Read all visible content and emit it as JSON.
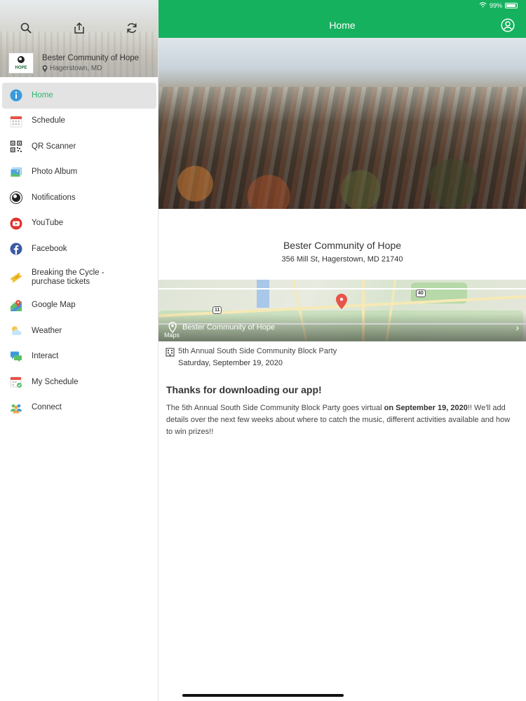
{
  "status_bar": {
    "wifi_icon": "wifi-icon",
    "battery": "99%"
  },
  "sidebar": {
    "org_name": "Bester Community of Hope",
    "org_location": "Hagerstown, MD",
    "logo_text": "HOPE",
    "tools": [
      "search-icon",
      "share-icon",
      "refresh-icon"
    ],
    "items": [
      {
        "label": "Home",
        "icon": "info-icon",
        "active": true
      },
      {
        "label": "Schedule",
        "icon": "calendar-icon"
      },
      {
        "label": "QR Scanner",
        "icon": "qr-code-icon"
      },
      {
        "label": "Photo Album",
        "icon": "photo-album-icon"
      },
      {
        "label": "Notifications",
        "icon": "notifications-icon"
      },
      {
        "label": "YouTube",
        "icon": "youtube-icon"
      },
      {
        "label": "Facebook",
        "icon": "facebook-icon"
      },
      {
        "label": "Breaking the Cycle - purchase tickets",
        "icon": "ticket-icon"
      },
      {
        "label": "Google Map",
        "icon": "map-icon"
      },
      {
        "label": "Weather",
        "icon": "weather-icon"
      },
      {
        "label": "Interact",
        "icon": "chat-icon"
      },
      {
        "label": "My Schedule",
        "icon": "my-schedule-icon"
      },
      {
        "label": "Connect",
        "icon": "people-icon"
      }
    ]
  },
  "header": {
    "title": "Home",
    "accent": "#16b15e"
  },
  "main": {
    "org_title": "Bester Community of Hope",
    "org_address": "356 Mill St, Hagerstown, MD 21740",
    "map_label": "Bester Community of Hope",
    "map_provider": "Maps",
    "map_shields": [
      "11",
      "40"
    ],
    "event_title": "5th Annual South Side Community Block Party",
    "event_date": "Saturday, September 19, 2020",
    "welcome_title": "Thanks for downloading our app!",
    "welcome_body_1": "The 5th Annual South Side Community Block Party goes virtual ",
    "welcome_body_bold": "on September 19, 2020",
    "welcome_body_2": "!! We'll add details over the next few weeks about where to catch the music, different activities available and how to win prizes!!"
  }
}
